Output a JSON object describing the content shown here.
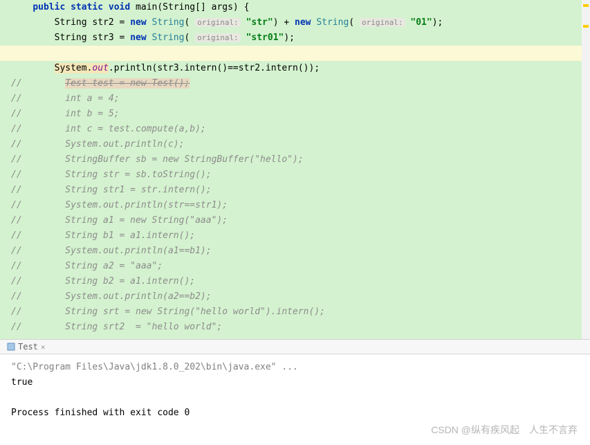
{
  "code": {
    "l0_pre": "    ",
    "l0_public": "public",
    "l0_static": " static ",
    "l0_void": "void",
    "l0_sig": " main(String[] args) {",
    "l1_pre": "        String str2 = ",
    "l1_new": "new",
    "l1_sp": " ",
    "l1_type": "String",
    "l1_paren": "( ",
    "l1_hint": "original:",
    "l1_sp2": " ",
    "l1_str1": "\"str\"",
    "l1_plus": ") + ",
    "l1_new2": "new",
    "l1_sp3": " ",
    "l1_type2": "String",
    "l1_paren2": "( ",
    "l1_hint2": "original:",
    "l1_sp4": " ",
    "l1_str2": "\"01\"",
    "l1_end": ");",
    "l2_pre": "        String str3 = ",
    "l2_new": "new",
    "l2_sp": " ",
    "l2_type": "String",
    "l2_paren": "( ",
    "l2_hint": "original:",
    "l2_sp2": " ",
    "l2_str": "\"str01\"",
    "l2_end": ");",
    "l3": "",
    "l4_pre": "        ",
    "l4_sys": "System.",
    "l4_out": "out",
    "l4_rest": ".println(str3.intern()==str2.intern());",
    "l5_pre": "//        ",
    "l5_test": "Test test = new Test();",
    "c6": "//        int a = 4;",
    "c7": "//        int b = 5;",
    "c8": "//        int c = test.compute(a,b);",
    "c9": "//        System.out.println(c);",
    "c10": "//        StringBuffer sb = new StringBuffer(\"hello\");",
    "c11": "//        String str = sb.toString();",
    "c12": "//        String str1 = str.intern();",
    "c13": "//        System.out.println(str==str1);",
    "c14": "//        String a1 = new String(\"aaa\");",
    "c15": "//        String b1 = a1.intern();",
    "c16": "//        System.out.println(a1==b1);",
    "c17": "//        String a2 = \"aaa\";",
    "c18": "//        String b2 = a1.intern();",
    "c19": "//        System.out.println(a2==b2);",
    "c20": "//        String srt = new String(\"hello world\").intern();",
    "c21": "//        String srt2  = \"hello world\";"
  },
  "tab": {
    "label": "Test",
    "close": "×"
  },
  "console": {
    "cmd": "\"C:\\Program Files\\Java\\jdk1.8.0_202\\bin\\java.exe\" ...",
    "out": "true",
    "exit": "Process finished with exit code 0"
  },
  "watermark": "CSDN @纵有疾风起　人生不言弃"
}
